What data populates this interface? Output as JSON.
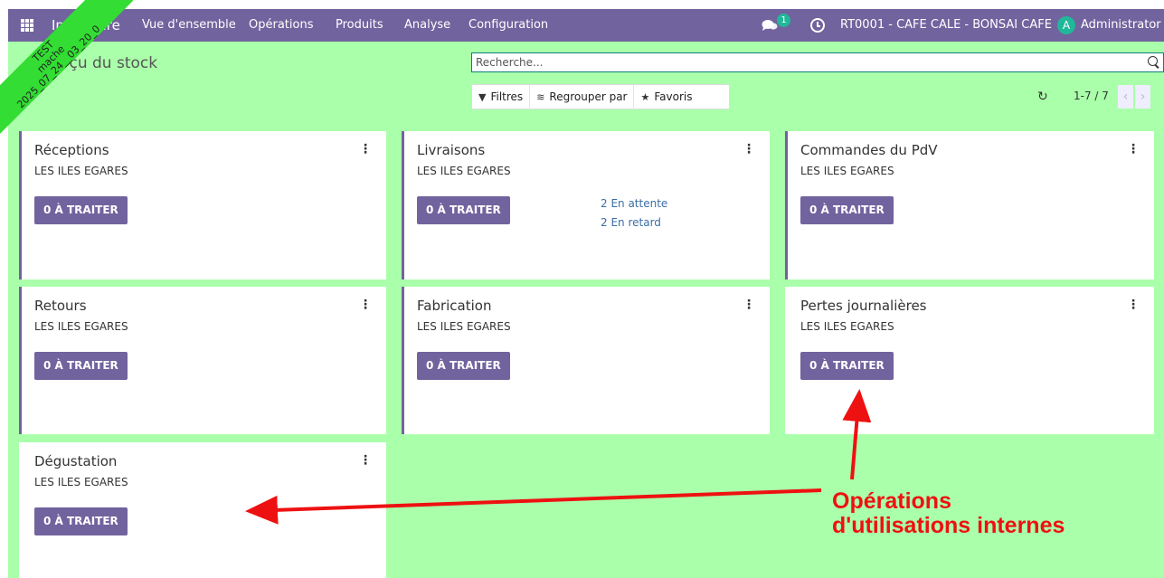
{
  "navbar": {
    "app_name": "Inventaire",
    "menu": [
      "Vue d'ensemble",
      "Opérations",
      "Produits",
      "Analyse",
      "Configuration"
    ],
    "chat_badge": "1",
    "company": "RT0001 - CAFE CALE - BONSAI CAFE",
    "avatar_letter": "A",
    "user": "Administrator"
  },
  "ribbon": {
    "line1": "TEST",
    "line2": "mache",
    "line3": "2025_07_24__03_20_0"
  },
  "page": {
    "breadcrumb": "Aperçu du stock",
    "search_placeholder": "Recherche...",
    "filters": "Filtres",
    "groupby": "Regrouper par",
    "favorites": "Favoris",
    "pager": "1-7 / 7"
  },
  "cards": [
    {
      "title": "Réceptions",
      "subtitle": "LES ILES EGARES",
      "button": "0 À TRAITER"
    },
    {
      "title": "Livraisons",
      "subtitle": "LES ILES EGARES",
      "button": "0 À TRAITER",
      "waiting": "2 En attente",
      "late": "2 En retard"
    },
    {
      "title": "Commandes du PdV",
      "subtitle": "LES ILES EGARES",
      "button": "0 À TRAITER"
    },
    {
      "title": "Retours",
      "subtitle": "LES ILES EGARES",
      "button": "0 À TRAITER"
    },
    {
      "title": "Fabrication",
      "subtitle": "LES ILES EGARES",
      "button": "0 À TRAITER"
    },
    {
      "title": "Pertes journalières",
      "subtitle": "LES ILES EGARES",
      "button": "0 À TRAITER"
    },
    {
      "title": "Dégustation",
      "subtitle": "LES ILES EGARES",
      "button": "0 À TRAITER"
    }
  ],
  "annotation": {
    "line1": "Opérations",
    "line2": "d'utilisations internes",
    "color": "#ee1111"
  },
  "colors": {
    "brand": "#71639e",
    "background": "#aaffaa",
    "badge": "#21b799"
  }
}
